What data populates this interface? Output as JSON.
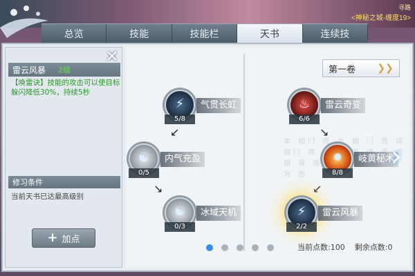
{
  "quest": {
    "title": "寻路",
    "text": "<神秘之城-缠度19>"
  },
  "tabs": [
    {
      "label": "总览"
    },
    {
      "label": "技能"
    },
    {
      "label": "技能栏"
    },
    {
      "label": "天书",
      "active": true
    },
    {
      "label": "连续技"
    }
  ],
  "skill": {
    "name": "雷云风暴",
    "level": "2级",
    "desc_prefix": "【唤雷诀】技能的攻击可以使目标躲闪降低",
    "desc_value": "30%",
    "desc_mid": "，持续",
    "desc_duration": "5秒"
  },
  "condition": {
    "title": "修习条件",
    "text": "当前天书已达最高级别"
  },
  "add_button": {
    "icon": "plus-icon",
    "label": "加点"
  },
  "book_select": {
    "value": "第一卷",
    "icon": "chevron-down-icon"
  },
  "nodes": [
    {
      "name": "气贯长虹",
      "count": "5/8"
    },
    {
      "name": "内气充盈",
      "count": "0/5"
    },
    {
      "name": "冰域天机",
      "count": "0/3"
    },
    {
      "name": "雷云奇变",
      "count": "6/6"
    },
    {
      "name": "岐黄秘术",
      "count": "8/8"
    },
    {
      "name": "雷云风暴",
      "count": "2/2"
    }
  ],
  "bg_text": "本 相门 而 为 相 门 而 得 相门 而 得 门 而 涉 得 而 相 得 而 游 得 而 得 相 为 而",
  "points": {
    "used_label": "当前点数:",
    "used_value": "100",
    "remain_label": "剩余点数:",
    "remain_value": "0"
  },
  "pages": {
    "count": 5,
    "current": 1
  },
  "colors": {
    "accent": "#3a8ee0",
    "highlight": "#2a9b2a",
    "level": "#5ee34d"
  }
}
